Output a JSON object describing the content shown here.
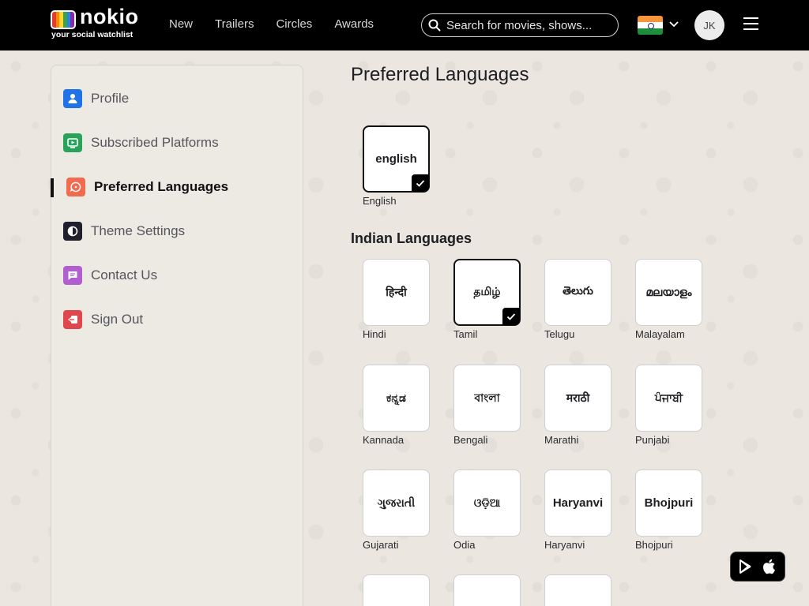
{
  "header": {
    "logo_word": "nokio",
    "logo_tagline": "your social watchlist",
    "nav": [
      "New",
      "Trailers",
      "Circles",
      "Awards"
    ],
    "search_placeholder": "Search for movies, shows...",
    "avatar_initials": "JK",
    "logo_colors": [
      "#e53935",
      "#fb8c00",
      "#fdd835",
      "#43a047",
      "#1e88e5",
      "#8e24aa"
    ]
  },
  "sidebar": {
    "items": [
      {
        "label": "Profile",
        "icon": "person-icon",
        "color": "#1e73e8"
      },
      {
        "label": "Subscribed Platforms",
        "icon": "tv-play-icon",
        "color": "#2aa35a"
      },
      {
        "label": "Preferred Languages",
        "icon": "speech-bubble-icon",
        "color": "#f26b4f",
        "active": true
      },
      {
        "label": "Theme Settings",
        "icon": "half-circle-icon",
        "color": "#1f1f2e"
      },
      {
        "label": "Contact Us",
        "icon": "chat-icon",
        "color": "#b15ed0"
      },
      {
        "label": "Sign Out",
        "icon": "logout-icon",
        "color": "#e0474c"
      }
    ]
  },
  "main": {
    "title": "Preferred Languages",
    "section_title": "Indian Languages",
    "featured": {
      "native": "english",
      "label": "English",
      "selected": true
    },
    "languages": [
      {
        "native": "हिन्दी",
        "label": "Hindi",
        "selected": false
      },
      {
        "native": "தமிழ்",
        "label": "Tamil",
        "selected": true
      },
      {
        "native": "తెలుగు",
        "label": "Telugu",
        "selected": false
      },
      {
        "native": "മലയാളം",
        "label": "Malayalam",
        "selected": false
      },
      {
        "native": "ಕನ್ನಡ",
        "label": "Kannada",
        "selected": false
      },
      {
        "native": "বাংলা",
        "label": "Bengali",
        "selected": false
      },
      {
        "native": "मराठी",
        "label": "Marathi",
        "selected": false
      },
      {
        "native": "ਪੰਜਾਬੀ",
        "label": "Punjabi",
        "selected": false
      },
      {
        "native": "ગુજરાતી",
        "label": "Gujarati",
        "selected": false
      },
      {
        "native": "ଓଡ଼ିଆ",
        "label": "Odia",
        "selected": false
      },
      {
        "native": "Haryanvi",
        "label": "Haryanvi",
        "selected": false
      },
      {
        "native": "Bhojpuri",
        "label": "Bhojpuri",
        "selected": false
      }
    ]
  },
  "app_badge": {
    "icons": [
      "play-store-icon",
      "apple-icon"
    ]
  }
}
